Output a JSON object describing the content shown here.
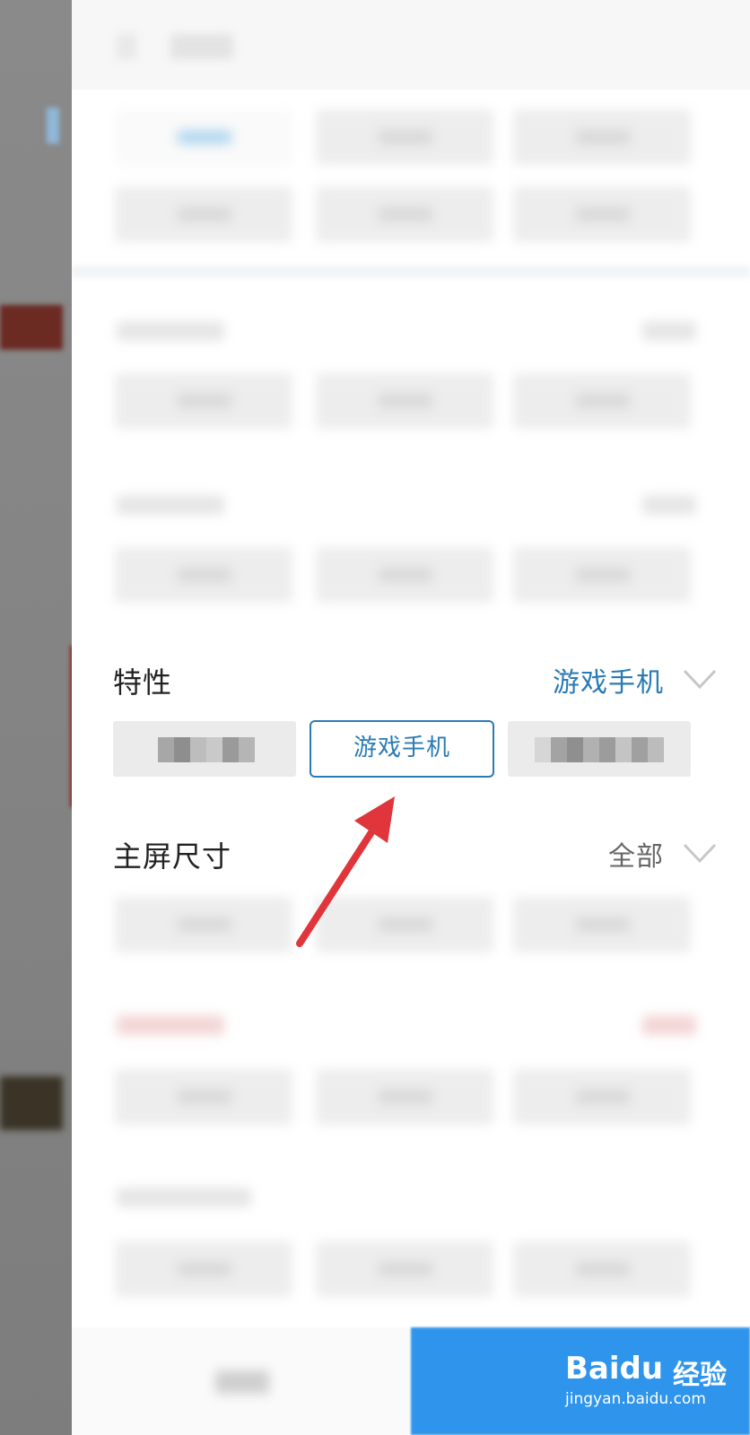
{
  "filter_panel": {
    "feature_section": {
      "title": "特性",
      "selected_value": "游戏手机",
      "options": [
        "",
        "游戏手机",
        ""
      ]
    },
    "screen_size_section": {
      "title": "主屏尺寸",
      "selected_value": "全部"
    }
  },
  "watermark": {
    "brand": "Baidu",
    "brand_cn": "经验",
    "url": "jingyan.baidu.com"
  },
  "colors": {
    "accent_blue": "#2a7bb5",
    "confirm_blue": "#2f95ec",
    "arrow_red": "#e0353a"
  },
  "icons": {
    "dropdown": "chevron-down-icon",
    "annotation": "red-arrow-annotation"
  }
}
